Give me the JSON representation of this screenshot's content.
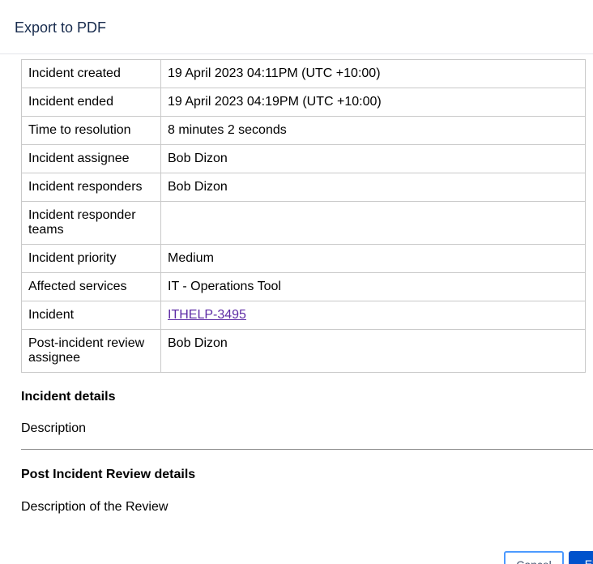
{
  "dialog": {
    "title": "Export to PDF"
  },
  "summary_rows": [
    {
      "label": "Incident created",
      "value": "19 April 2023 04:11PM (UTC +10:00)"
    },
    {
      "label": "Incident ended",
      "value": "19 April 2023 04:19PM (UTC +10:00)"
    },
    {
      "label": "Time to resolution",
      "value": "8 minutes 2 seconds"
    },
    {
      "label": "Incident assignee",
      "value": "Bob Dizon"
    },
    {
      "label": "Incident responders",
      "value": "Bob Dizon"
    },
    {
      "label": "Incident responder teams",
      "value": ""
    },
    {
      "label": "Incident priority",
      "value": "Medium"
    },
    {
      "label": "Affected services",
      "value": "IT - Operations Tool"
    },
    {
      "label": "Incident",
      "value": "ITHELP-3495"
    },
    {
      "label": "Post-incident review assignee",
      "value": "Bob Dizon"
    }
  ],
  "incident_details": {
    "title": "Incident details",
    "description": "Description"
  },
  "pir_details": {
    "title": "Post Incident Review details",
    "description": "Description of the Review"
  },
  "footer": {
    "cancel_label": "Cancel",
    "export_label": "Export"
  }
}
